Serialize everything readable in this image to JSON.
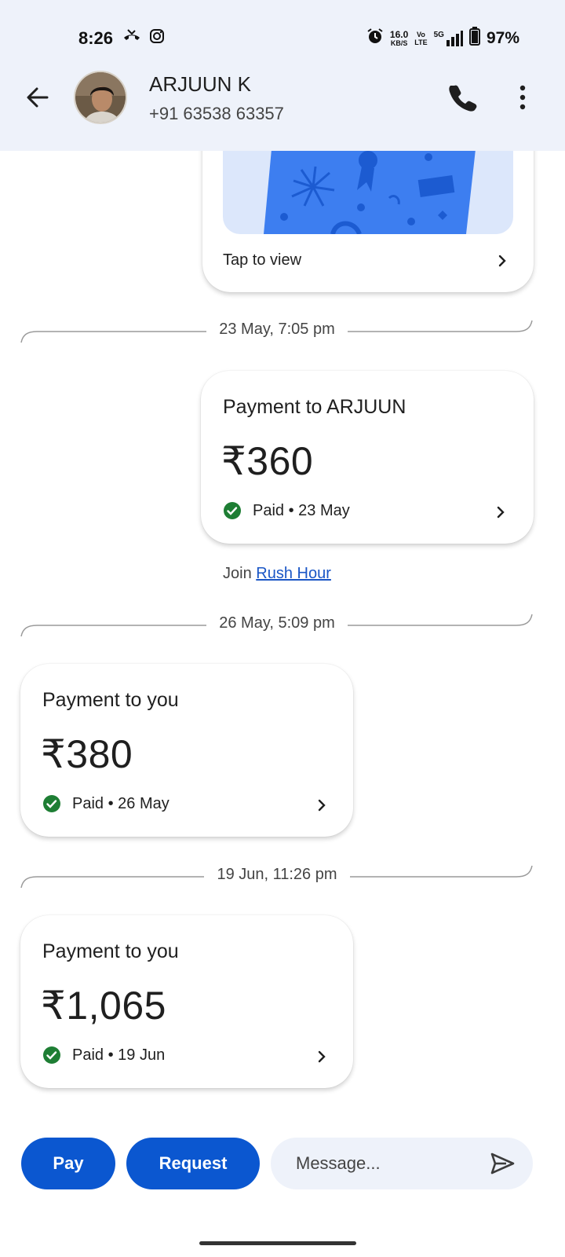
{
  "status_bar": {
    "time": "8:26",
    "net_speed_value": "16.0",
    "net_speed_unit": "KB/S",
    "volte_top": "Vo",
    "volte_bottom": "LTE",
    "network": "5G",
    "battery": "97%"
  },
  "header": {
    "contact_name": "ARJUUN K",
    "contact_phone": "+91 63538 63357"
  },
  "messages": {
    "gift_card": {
      "action_label": "Tap to view"
    },
    "divider_1": "23 May, 7:05 pm",
    "payment_1": {
      "title": "Payment to ARJUUN",
      "amount": "₹360",
      "status": "Paid • 23 May"
    },
    "join_prefix": "Join",
    "join_link": "Rush Hour",
    "divider_2": "26 May, 5:09 pm",
    "payment_2": {
      "title": "Payment to you",
      "amount": "₹380",
      "status": "Paid • 26 May"
    },
    "divider_3": "19 Jun, 11:26 pm",
    "payment_3": {
      "title": "Payment to you",
      "amount": "₹1,065",
      "status": "Paid • 19 Jun"
    }
  },
  "bottom_bar": {
    "pay_label": "Pay",
    "request_label": "Request",
    "message_placeholder": "Message..."
  },
  "colors": {
    "accent": "#0b57d0",
    "header_bg": "#eef2fa",
    "paid_green": "#1e7e34",
    "link": "#1a56c6"
  }
}
